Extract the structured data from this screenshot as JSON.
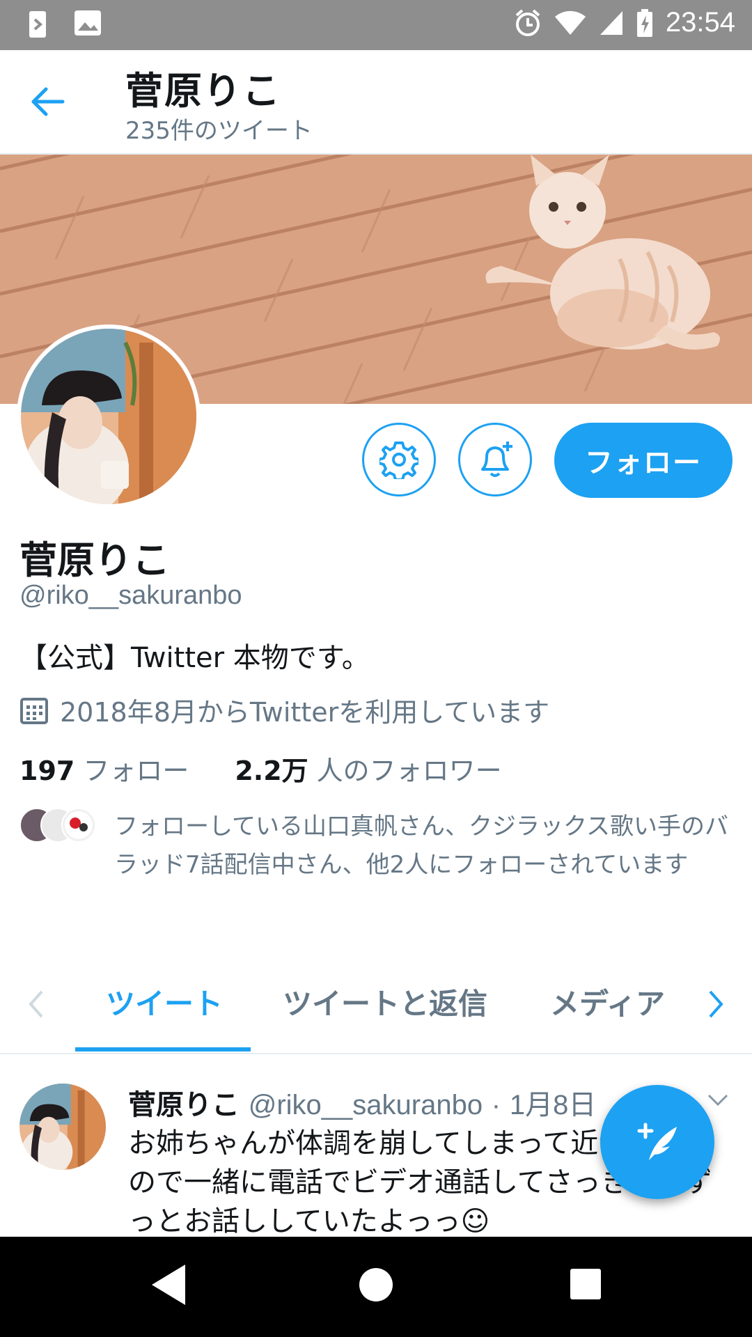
{
  "status_bar": {
    "time": "23:54"
  },
  "header": {
    "title": "菅原りこ",
    "tweet_count": "235件のツイート"
  },
  "actions": {
    "follow_label": "フォロー"
  },
  "profile": {
    "name": "菅原りこ",
    "handle": "@riko__sakuranbo",
    "bio": "【公式】Twitter 本物です。",
    "joined": "2018年8月からTwitterを利用しています",
    "following_count": "197",
    "following_label": "フォロー",
    "followers_count": "2.2万",
    "followers_label": "人のフォロワー",
    "followed_by_text": "フォローしている山口真帆さん、クジラックス歌い手のバラッド7話配信中さん、他2人にフォローされています"
  },
  "tabs": [
    {
      "label": "ツイート"
    },
    {
      "label": "ツイートと返信"
    },
    {
      "label": "メディア"
    }
  ],
  "tweet": {
    "author": "菅原りこ",
    "handle": "@riko__sakuranbo",
    "separator": "·",
    "date": "1月8日",
    "text": "お姉ちゃんが体調を崩してしまって近づけないので一緒に電話でビデオ通話してさっきまでずっとお話ししていたよっっ☺"
  },
  "colors": {
    "accent": "#1da1f2",
    "secondary_text": "#657786",
    "status_bar": "#8e8e8e"
  },
  "icons": [
    "back-arrow-icon",
    "gear-icon",
    "bell-plus-icon",
    "calendar-icon",
    "chevron-left-icon",
    "chevron-right-icon",
    "chevron-down-icon",
    "compose-icon",
    "nav-back-icon",
    "nav-home-icon",
    "nav-recents-icon"
  ]
}
